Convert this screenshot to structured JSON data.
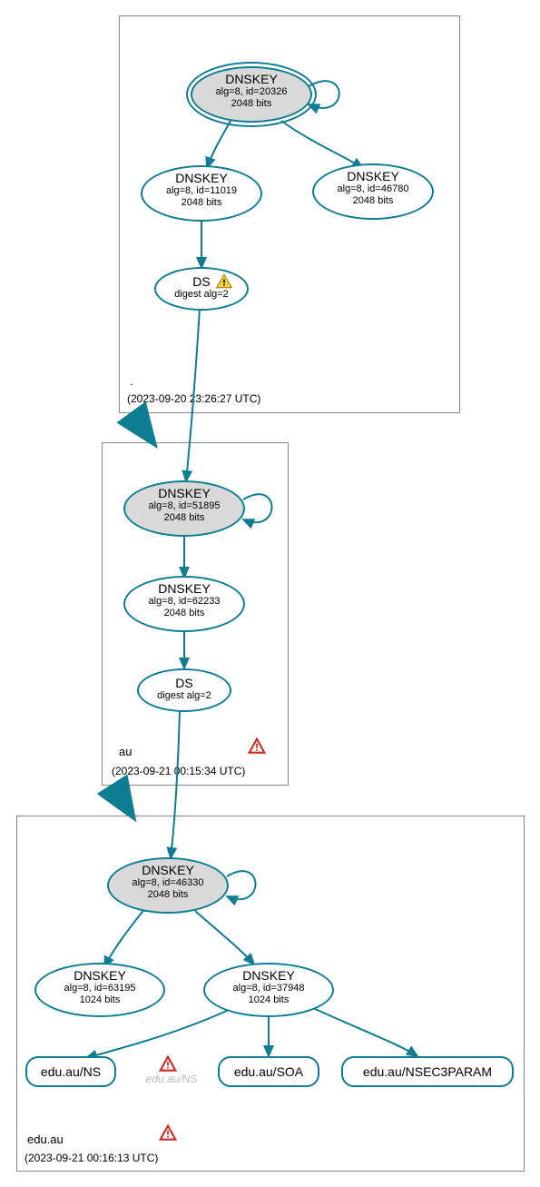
{
  "zones": {
    "root": {
      "label": ".",
      "timestamp": "(2023-09-20 23:26:27 UTC)"
    },
    "au": {
      "label": "au",
      "timestamp": "(2023-09-21 00:15:34 UTC)"
    },
    "edu": {
      "label": "edu.au",
      "timestamp": "(2023-09-21 00:16:13 UTC)"
    }
  },
  "nodes": {
    "root_ksk": {
      "title": "DNSKEY",
      "line2": "alg=8, id=20326",
      "line3": "2048 bits"
    },
    "root_zsk1": {
      "title": "DNSKEY",
      "line2": "alg=8, id=11019",
      "line3": "2048 bits"
    },
    "root_zsk2": {
      "title": "DNSKEY",
      "line2": "alg=8, id=46780",
      "line3": "2048 bits"
    },
    "root_ds": {
      "title": "DS",
      "sub": "digest alg=2"
    },
    "au_ksk": {
      "title": "DNSKEY",
      "line2": "alg=8, id=51895",
      "line3": "2048 bits"
    },
    "au_zsk": {
      "title": "DNSKEY",
      "line2": "alg=8, id=62233",
      "line3": "2048 bits"
    },
    "au_ds": {
      "title": "DS",
      "sub": "digest alg=2"
    },
    "edu_ksk": {
      "title": "DNSKEY",
      "line2": "alg=8, id=46330",
      "line3": "2048 bits"
    },
    "edu_zsk1": {
      "title": "DNSKEY",
      "line2": "alg=8, id=63195",
      "line3": "1024 bits"
    },
    "edu_zsk2": {
      "title": "DNSKEY",
      "line2": "alg=8, id=37948",
      "line3": "1024 bits"
    },
    "rr_ns": {
      "label": "edu.au/NS"
    },
    "rr_ns_faded": {
      "label": "edu.au/NS"
    },
    "rr_soa": {
      "label": "edu.au/SOA"
    },
    "rr_nsec3": {
      "label": "edu.au/NSEC3PARAM"
    }
  },
  "colors": {
    "stroke": "#0d7d93",
    "ksk_fill": "#d9d9d9",
    "warn_yellow": "#f7d33c",
    "warn_red": "#cc2a1f",
    "faded": "#bdbdbd"
  }
}
